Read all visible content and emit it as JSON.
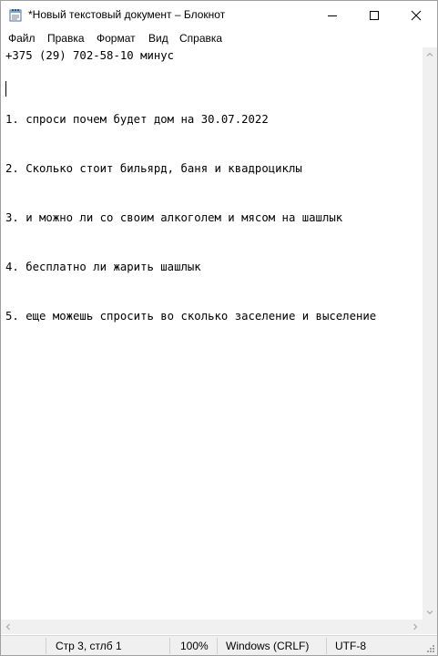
{
  "window": {
    "title": "*Новый текстовый документ – Блокнот",
    "icon": "notepad-icon"
  },
  "menu": {
    "file": "Файл",
    "edit": "Правка",
    "format": "Формат",
    "view": "Вид",
    "help": "Справка"
  },
  "editor": {
    "lines": [
      "+375 (29) 702-58-10 минус",
      "1. спроси почем будет дом на 30.07.2022",
      "2. Сколько стоит бильярд, баня и квадроциклы",
      "3. и можно ли со своим алкоголем и мясом на шашлык",
      "4. бесплатно ли жарить шашлык",
      "5. еще можешь спросить во сколько заселение и выселение"
    ]
  },
  "status": {
    "position": "Стр 3, стлб 1",
    "zoom": "100%",
    "line_endings": "Windows (CRLF)",
    "encoding": "UTF-8"
  }
}
